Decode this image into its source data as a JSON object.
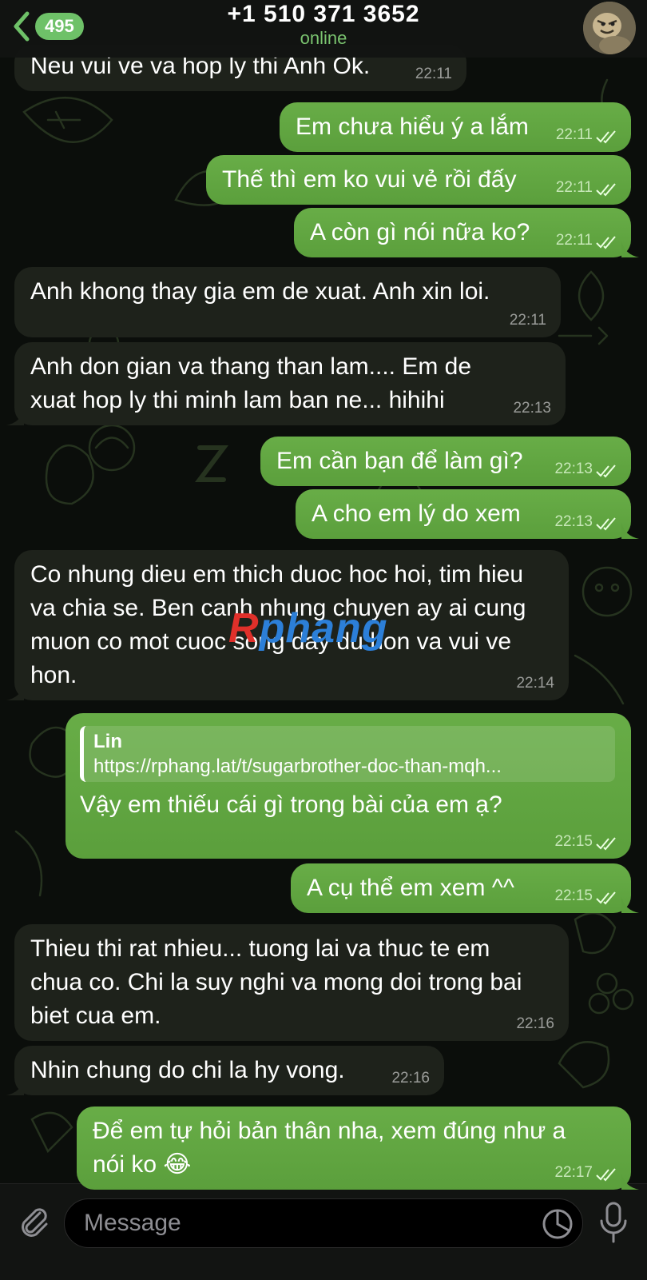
{
  "header": {
    "back_count": "495",
    "title": "+1 510 371 3652",
    "status": "online"
  },
  "messages": [
    {
      "dir": "in",
      "text": "Neu vui ve va hop ly thi Anh Ok.",
      "time": "22:11"
    },
    {
      "dir": "out",
      "text": "Em chưa hiểu ý a lắm",
      "time": "22:11"
    },
    {
      "dir": "out",
      "text": "Thế thì em ko vui vẻ rồi đấy",
      "time": "22:11"
    },
    {
      "dir": "out",
      "text": "A còn gì nói nữa ko?",
      "time": "22:11"
    },
    {
      "dir": "in",
      "text": "Anh khong thay gia em de xuat. Anh xin loi.",
      "time": "22:11"
    },
    {
      "dir": "in",
      "text": "Anh don gian va thang than lam.... Em de xuat hop ly thi minh lam ban ne... hihihi",
      "time": "22:13"
    },
    {
      "dir": "out",
      "text": "Em cần bạn để làm gì?",
      "time": "22:13"
    },
    {
      "dir": "out",
      "text": "A cho em lý do xem",
      "time": "22:13"
    },
    {
      "dir": "in",
      "text": "Co nhung dieu em thich duoc hoc hoi, tim hieu va chia se. Ben canh nhung chuyen ay ai cung muon co mot cuoc song day du hon va vui ve hon.",
      "time": "22:14"
    },
    {
      "dir": "out",
      "reply_name": "Lin",
      "reply_text": "https://rphang.lat/t/sugarbrother-doc-than-mqh...",
      "text": "Vậy em thiếu cái gì trong bài của em ạ?",
      "time": "22:15"
    },
    {
      "dir": "out",
      "text": "A cụ thể em xem ^^",
      "time": "22:15"
    },
    {
      "dir": "in",
      "text": "Thieu thi rat nhieu... tuong lai va thuc te em chua co. Chi la suy nghi va mong doi trong bai biet cua em.",
      "time": "22:16"
    },
    {
      "dir": "in",
      "text": "Nhin chung do chi la hy vong.",
      "time": "22:16"
    },
    {
      "dir": "out",
      "text": "Để em tự hỏi bản thân nha, xem đúng như a nói ko 😂",
      "time": "22:17"
    }
  ],
  "watermark": {
    "first": "R",
    "rest": "phang"
  },
  "composer": {
    "placeholder": "Message"
  },
  "colors": {
    "outgoing": "#5fa640",
    "incoming": "#1e221b",
    "accent": "#6ec168"
  }
}
